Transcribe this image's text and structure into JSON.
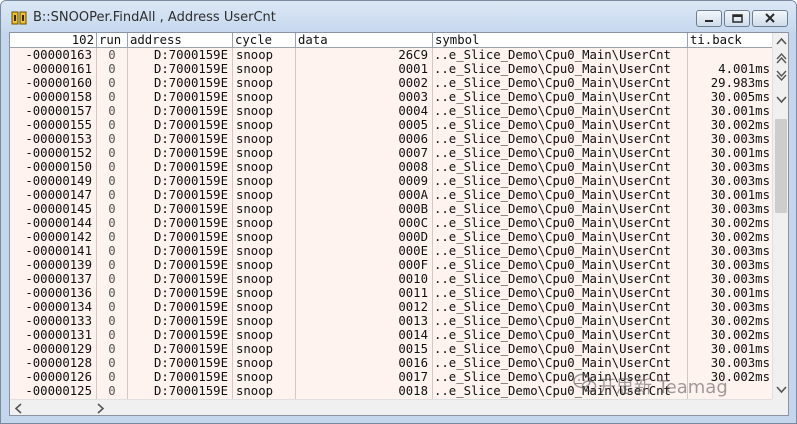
{
  "window": {
    "title": "B::SNOOPer.FindAll , Address UserCnt"
  },
  "table": {
    "columns": [
      {
        "key": "record",
        "label": "102"
      },
      {
        "key": "run",
        "label": "run"
      },
      {
        "key": "address",
        "label": "address"
      },
      {
        "key": "cycle",
        "label": "cycle"
      },
      {
        "key": "data",
        "label": "data"
      },
      {
        "key": "symbol",
        "label": "symbol"
      },
      {
        "key": "ti_back",
        "label": "ti.back"
      }
    ],
    "rows": [
      {
        "record": "-00000163",
        "run": "0",
        "address": "D:7000159E",
        "cycle": "snoop",
        "data": "26C9",
        "symbol": "..e_Slice_Demo\\Cpu0_Main\\UserCnt",
        "ti_back": ""
      },
      {
        "record": "-00000161",
        "run": "0",
        "address": "D:7000159E",
        "cycle": "snoop",
        "data": "0001",
        "symbol": "..e_Slice_Demo\\Cpu0_Main\\UserCnt",
        "ti_back": "4.001ms"
      },
      {
        "record": "-00000160",
        "run": "0",
        "address": "D:7000159E",
        "cycle": "snoop",
        "data": "0002",
        "symbol": "..e_Slice_Demo\\Cpu0_Main\\UserCnt",
        "ti_back": "29.983ms"
      },
      {
        "record": "-00000158",
        "run": "0",
        "address": "D:7000159E",
        "cycle": "snoop",
        "data": "0003",
        "symbol": "..e_Slice_Demo\\Cpu0_Main\\UserCnt",
        "ti_back": "30.005ms"
      },
      {
        "record": "-00000157",
        "run": "0",
        "address": "D:7000159E",
        "cycle": "snoop",
        "data": "0004",
        "symbol": "..e_Slice_Demo\\Cpu0_Main\\UserCnt",
        "ti_back": "30.001ms"
      },
      {
        "record": "-00000155",
        "run": "0",
        "address": "D:7000159E",
        "cycle": "snoop",
        "data": "0005",
        "symbol": "..e_Slice_Demo\\Cpu0_Main\\UserCnt",
        "ti_back": "30.002ms"
      },
      {
        "record": "-00000153",
        "run": "0",
        "address": "D:7000159E",
        "cycle": "snoop",
        "data": "0006",
        "symbol": "..e_Slice_Demo\\Cpu0_Main\\UserCnt",
        "ti_back": "30.003ms"
      },
      {
        "record": "-00000152",
        "run": "0",
        "address": "D:7000159E",
        "cycle": "snoop",
        "data": "0007",
        "symbol": "..e_Slice_Demo\\Cpu0_Main\\UserCnt",
        "ti_back": "30.001ms"
      },
      {
        "record": "-00000150",
        "run": "0",
        "address": "D:7000159E",
        "cycle": "snoop",
        "data": "0008",
        "symbol": "..e_Slice_Demo\\Cpu0_Main\\UserCnt",
        "ti_back": "30.003ms"
      },
      {
        "record": "-00000149",
        "run": "0",
        "address": "D:7000159E",
        "cycle": "snoop",
        "data": "0009",
        "symbol": "..e_Slice_Demo\\Cpu0_Main\\UserCnt",
        "ti_back": "30.003ms"
      },
      {
        "record": "-00000147",
        "run": "0",
        "address": "D:7000159E",
        "cycle": "snoop",
        "data": "000A",
        "symbol": "..e_Slice_Demo\\Cpu0_Main\\UserCnt",
        "ti_back": "30.001ms"
      },
      {
        "record": "-00000145",
        "run": "0",
        "address": "D:7000159E",
        "cycle": "snoop",
        "data": "000B",
        "symbol": "..e_Slice_Demo\\Cpu0_Main\\UserCnt",
        "ti_back": "30.003ms"
      },
      {
        "record": "-00000144",
        "run": "0",
        "address": "D:7000159E",
        "cycle": "snoop",
        "data": "000C",
        "symbol": "..e_Slice_Demo\\Cpu0_Main\\UserCnt",
        "ti_back": "30.002ms"
      },
      {
        "record": "-00000142",
        "run": "0",
        "address": "D:7000159E",
        "cycle": "snoop",
        "data": "000D",
        "symbol": "..e_Slice_Demo\\Cpu0_Main\\UserCnt",
        "ti_back": "30.002ms"
      },
      {
        "record": "-00000141",
        "run": "0",
        "address": "D:7000159E",
        "cycle": "snoop",
        "data": "000E",
        "symbol": "..e_Slice_Demo\\Cpu0_Main\\UserCnt",
        "ti_back": "30.003ms"
      },
      {
        "record": "-00000139",
        "run": "0",
        "address": "D:7000159E",
        "cycle": "snoop",
        "data": "000F",
        "symbol": "..e_Slice_Demo\\Cpu0_Main\\UserCnt",
        "ti_back": "30.003ms"
      },
      {
        "record": "-00000137",
        "run": "0",
        "address": "D:7000159E",
        "cycle": "snoop",
        "data": "0010",
        "symbol": "..e_Slice_Demo\\Cpu0_Main\\UserCnt",
        "ti_back": "30.003ms"
      },
      {
        "record": "-00000136",
        "run": "0",
        "address": "D:7000159E",
        "cycle": "snoop",
        "data": "0011",
        "symbol": "..e_Slice_Demo\\Cpu0_Main\\UserCnt",
        "ti_back": "30.001ms"
      },
      {
        "record": "-00000134",
        "run": "0",
        "address": "D:7000159E",
        "cycle": "snoop",
        "data": "0012",
        "symbol": "..e_Slice_Demo\\Cpu0_Main\\UserCnt",
        "ti_back": "30.003ms"
      },
      {
        "record": "-00000133",
        "run": "0",
        "address": "D:7000159E",
        "cycle": "snoop",
        "data": "0013",
        "symbol": "..e_Slice_Demo\\Cpu0_Main\\UserCnt",
        "ti_back": "30.002ms"
      },
      {
        "record": "-00000131",
        "run": "0",
        "address": "D:7000159E",
        "cycle": "snoop",
        "data": "0014",
        "symbol": "..e_Slice_Demo\\Cpu0_Main\\UserCnt",
        "ti_back": "30.002ms"
      },
      {
        "record": "-00000129",
        "run": "0",
        "address": "D:7000159E",
        "cycle": "snoop",
        "data": "0015",
        "symbol": "..e_Slice_Demo\\Cpu0_Main\\UserCnt",
        "ti_back": "30.001ms"
      },
      {
        "record": "-00000128",
        "run": "0",
        "address": "D:7000159E",
        "cycle": "snoop",
        "data": "0016",
        "symbol": "..e_Slice_Demo\\Cpu0_Main\\UserCnt",
        "ti_back": "30.003ms"
      },
      {
        "record": "-00000126",
        "run": "0",
        "address": "D:7000159E",
        "cycle": "snoop",
        "data": "0017",
        "symbol": "..e_Slice_Demo\\Cpu0_Main\\UserCnt",
        "ti_back": "30.002ms"
      },
      {
        "record": "-00000125",
        "run": "0",
        "address": "D:7000159E",
        "cycle": "snoop",
        "data": "0018",
        "symbol": "..e_Slice_Demo\\Cpu0_Main\\UserCnt",
        "ti_back": ""
      }
    ]
  },
  "watermark": {
    "text": "开思新 Teamag",
    "icon": "wechat-icon"
  },
  "icons": {
    "app": "trace32-icon",
    "minimize": "minimize-icon",
    "maximize": "maximize-icon",
    "close": "close-icon"
  },
  "colors": {
    "titlebar": "#c6d8ee",
    "row_background": "#fff3f0",
    "text": "#101010"
  }
}
